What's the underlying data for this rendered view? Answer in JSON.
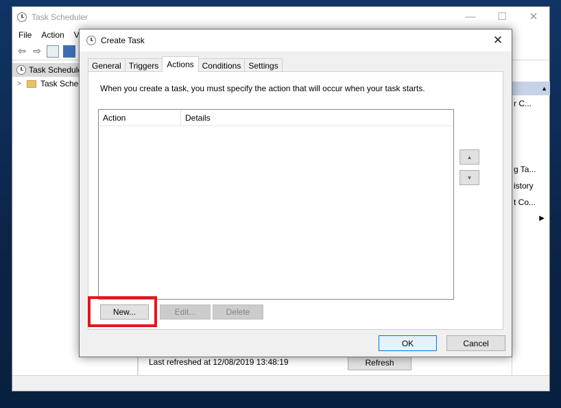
{
  "colors": {
    "accent": "#0078d7",
    "highlight": "#e5151b",
    "desktop": "#0d2d55"
  },
  "background_window": {
    "title": "Task Scheduler",
    "controls": {
      "minimize": "—",
      "maximize": "☐",
      "close": "✕"
    },
    "menu": [
      "File",
      "Action",
      "V"
    ],
    "tree": [
      {
        "label": "Task Scheduler",
        "icon": "clock-icon"
      },
      {
        "label": "Task Sched",
        "icon": "folder-icon"
      }
    ],
    "actions_pane": [
      "r C...",
      "g Ta...",
      "istory",
      "t Co..."
    ],
    "status": {
      "last_refreshed": "Last refreshed at 12/08/2019 13:48:19",
      "refresh_label": "Refresh"
    }
  },
  "dialog": {
    "title": "Create Task",
    "close_label": "✕",
    "tabs": [
      "General",
      "Triggers",
      "Actions",
      "Conditions",
      "Settings"
    ],
    "active_tab": "Actions",
    "instruction": "When you create a task, you must specify the action that will occur when your task starts.",
    "list": {
      "columns": [
        "Action",
        "Details"
      ],
      "rows": []
    },
    "move_up_label": "▲",
    "move_down_label": "▼",
    "buttons": {
      "new": "New...",
      "edit": "Edit...",
      "delete": "Delete"
    },
    "ok_label": "OK",
    "cancel_label": "Cancel"
  }
}
